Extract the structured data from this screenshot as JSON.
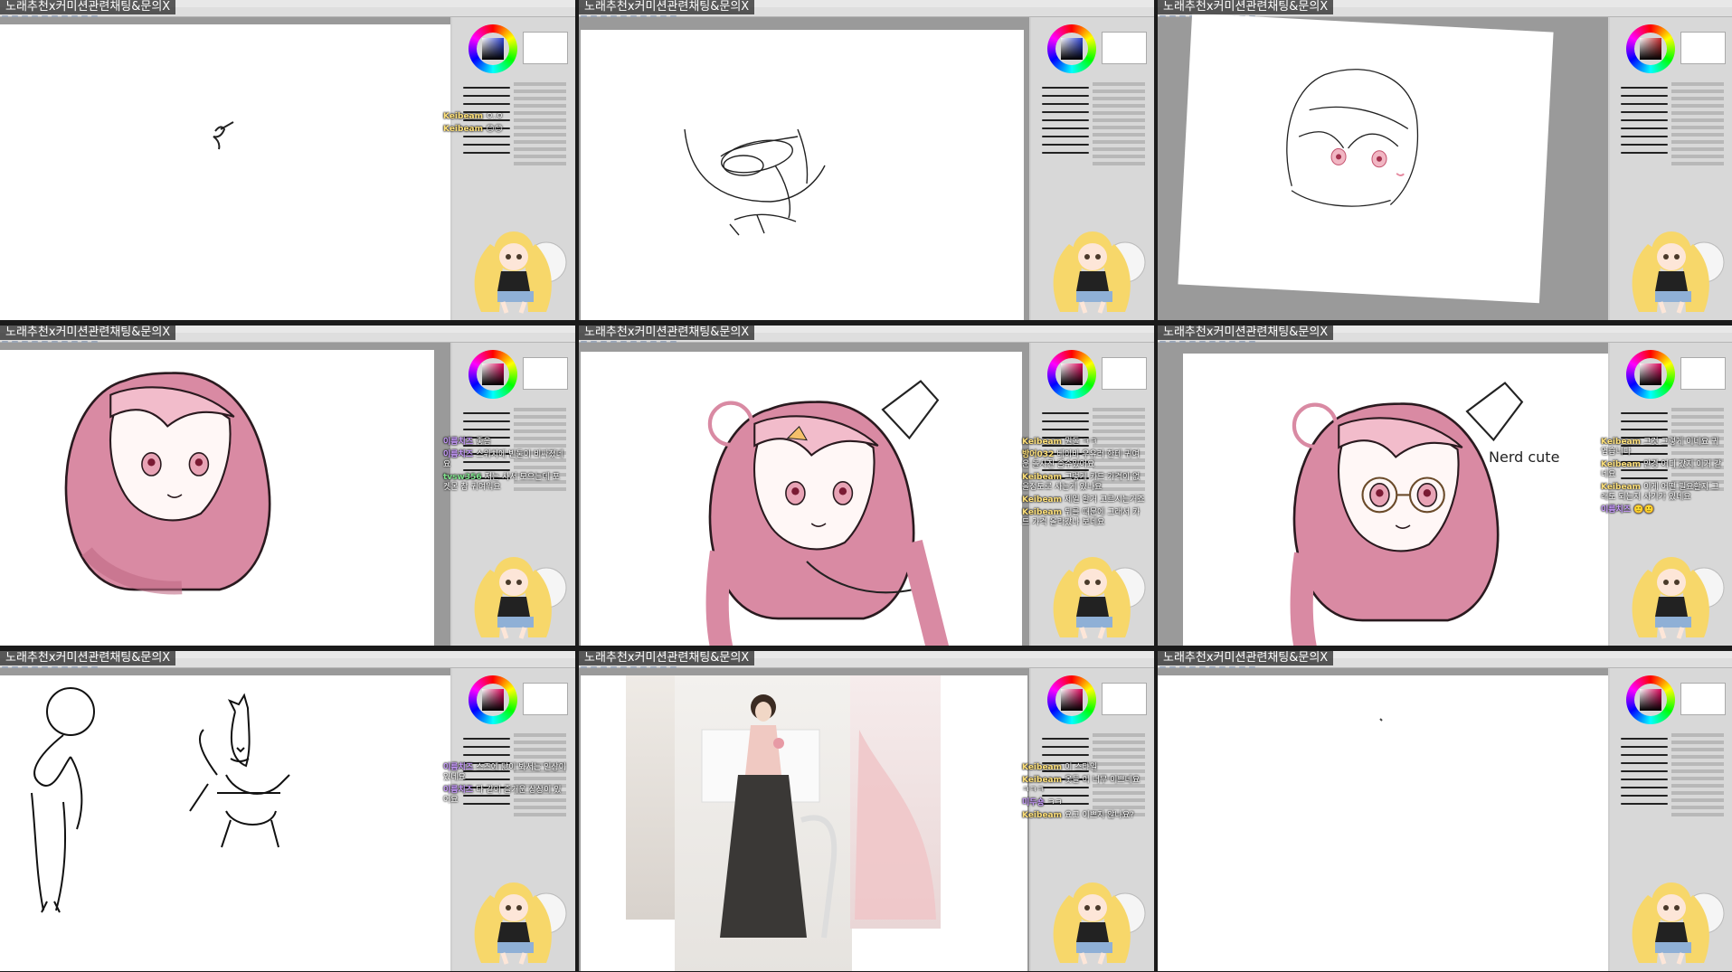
{
  "stream": {
    "overlay_title": "노래추천x커미션관련채팅&문의X"
  },
  "colors": {
    "hair_pink": "#d98aa3",
    "hair_light": "#f2bccb",
    "accent_yellow": "#f7d76a",
    "window_bg": "#cfcfcf",
    "panel_bg": "#d8d8d8"
  },
  "tiles": [
    {
      "id": "t1",
      "wheel_hue": "#2a3fd6",
      "chat": [
        {
          "user": "Keibeam",
          "text": "ㅇ.ㅇ",
          "color": "y"
        },
        {
          "user": "Keibeam",
          "text": "😊😊",
          "color": "y"
        }
      ]
    },
    {
      "id": "t2",
      "wheel_hue": "#2a3fd6",
      "chat": []
    },
    {
      "id": "t3",
      "wheel_hue": "#c8262a",
      "chat": []
    },
    {
      "id": "t4",
      "wheel_hue": "#e0005a",
      "chat": [
        {
          "user": "이름치즈",
          "text": "좋음",
          "color": "p"
        },
        {
          "user": "이름치즈",
          "text": "스위치에 빈둘이 비싸졌네요",
          "color": "p"
        },
        {
          "user": "tvsw356",
          "text": "저는 사서 모으는데 포켓몬 참 귀여워요",
          "color": "g"
        }
      ]
    },
    {
      "id": "t5",
      "wheel_hue": "#e0005a",
      "chat": [
        {
          "user": "Keibeam",
          "text": "뭔돌 ㅋㅋ",
          "color": "y"
        },
        {
          "user": "방어032",
          "text": "베이비 우유러 한테 귀여운 돌사진 줄수있어요",
          "color": "y"
        },
        {
          "user": "Keibeam",
          "text": "그렇게 카드 가격이 없을정도로 사는게 있나요",
          "color": "y"
        },
        {
          "user": "Keibeam",
          "text": "제일 할거 고르시는거죠",
          "color": "y"
        },
        {
          "user": "Keibeam",
          "text": "뒤를 때문에 그래서 카드 가격 올라갔나 보네요",
          "color": "y"
        }
      ]
    },
    {
      "id": "t6",
      "wheel_hue": "#e0005a",
      "caption": "Nerd cute",
      "chat": [
        {
          "user": "Keibeam",
          "text": "그것 그렇게 이네요 귀엽습니다",
          "color": "y"
        },
        {
          "user": "Keibeam",
          "text": "안경 어디 갔지 이거 같네요",
          "color": "y"
        },
        {
          "user": "Keibeam",
          "text": "이게 어떤 필요할지 그래도 되는지 사기가 있네요",
          "color": "y"
        },
        {
          "user": "이름치즈",
          "text": "🙂🙂",
          "color": "p"
        }
      ]
    },
    {
      "id": "t7",
      "wheel_hue": "#e0005a",
      "chat": [
        {
          "user": "이름치즈",
          "text": "스즈에 닮이 봐서는 인상이 있네요",
          "color": "p"
        },
        {
          "user": "이름치즈",
          "text": "다 같이 즐거운 상상이 있어요",
          "color": "p"
        }
      ]
    },
    {
      "id": "t8",
      "wheel_hue": "#e0005a",
      "chat": [
        {
          "user": "Keibeam",
          "text": "이 스타일",
          "color": "y"
        },
        {
          "user": "Keibeam",
          "text": "옷들 이 너무 이쁘네요 ㅋㅋㅋ",
          "color": "y"
        },
        {
          "user": "미두숑",
          "text": "ㅋㅋ",
          "color": "p"
        },
        {
          "user": "Keibeam",
          "text": "요고 이쁘지 않나요?",
          "color": "y"
        }
      ]
    },
    {
      "id": "t9",
      "wheel_hue": "#e0005a",
      "chat": []
    }
  ]
}
